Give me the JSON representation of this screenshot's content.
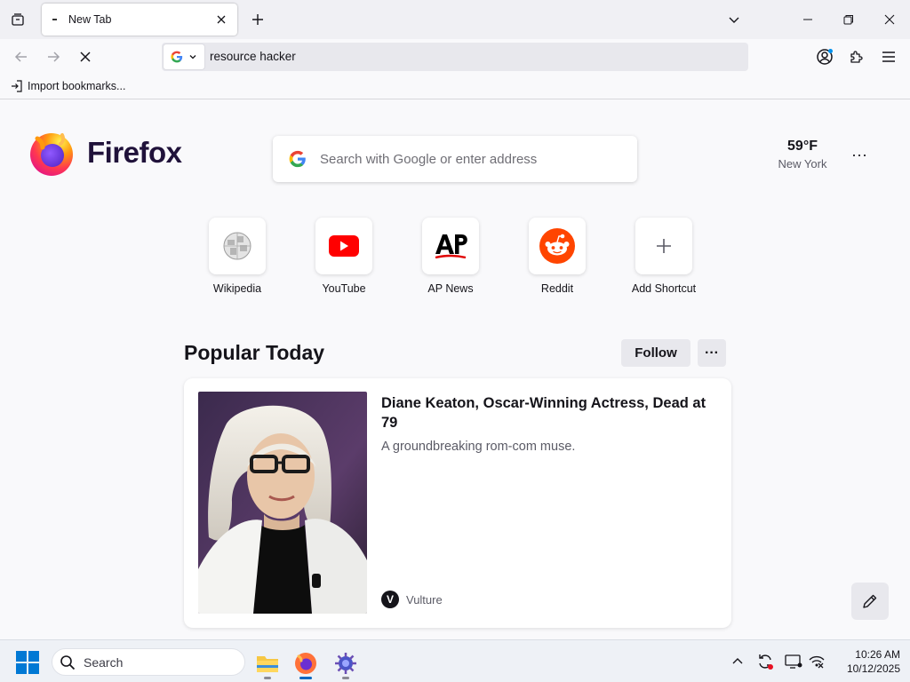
{
  "browser": {
    "tab": {
      "title": "New Tab"
    },
    "url": "resource hacker",
    "bookmarks": {
      "import_label": "Import bookmarks..."
    }
  },
  "newtab": {
    "brand": "Firefox",
    "search_placeholder": "Search with Google or enter address",
    "weather": {
      "temp": "59°F",
      "city": "New York"
    },
    "shortcuts": [
      {
        "label": "Wikipedia"
      },
      {
        "label": "YouTube"
      },
      {
        "label": "AP News"
      },
      {
        "label": "Reddit"
      },
      {
        "label": "Add Shortcut"
      }
    ],
    "popular": {
      "title": "Popular Today",
      "follow_label": "Follow",
      "menu_label": "···",
      "story": {
        "headline": "Diane Keaton, Oscar-Winning Actress, Dead at 79",
        "excerpt": "A groundbreaking rom-com muse.",
        "source": "Vulture",
        "source_logo_letter": "V"
      }
    },
    "weather_menu_label": "···"
  },
  "taskbar": {
    "search_label": "Search",
    "time": "10:26 AM",
    "date": "10/12/2025"
  },
  "colors": {
    "accent": "#0067c0",
    "firefox_orange": "#ff7139",
    "firefox_purple": "#592acb"
  }
}
